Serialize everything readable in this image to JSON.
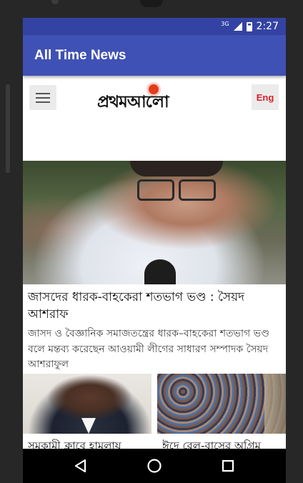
{
  "status_bar": {
    "network": "3G",
    "time": "2:27"
  },
  "app_bar": {
    "title": "All Time News"
  },
  "site_header": {
    "logo_text": "প্রথমআলো",
    "language_button": "Eng"
  },
  "lead_story": {
    "headline": "জাসদের ধারক-বাহকেরা শতভাগ ভণ্ড : সৈয়দ আশরাফ",
    "summary": "জাসদ ও বৈজ্ঞানিক সমাজতন্ত্রের ধারক–বাহকেরা শতভাগ ভণ্ড বলে মন্তব্য করেছেন আওয়ামী লীগের সাধারণ সম্পাদক সৈয়দ আশরাফুল"
  },
  "cards": [
    {
      "title": "সমকামী ক্লাবে হামলায়"
    },
    {
      "title": "ঈদে রেল-বাসের অগ্রিম"
    }
  ],
  "icons": {
    "menu": "hamburger-icon",
    "back": "back-triangle-icon",
    "home": "home-circle-icon",
    "recents": "recents-square-icon"
  },
  "colors": {
    "status_bar": "#3443a3",
    "app_bar": "#3f51b5",
    "logo_accent": "#e53b1a",
    "eng_text": "#d7212b"
  }
}
